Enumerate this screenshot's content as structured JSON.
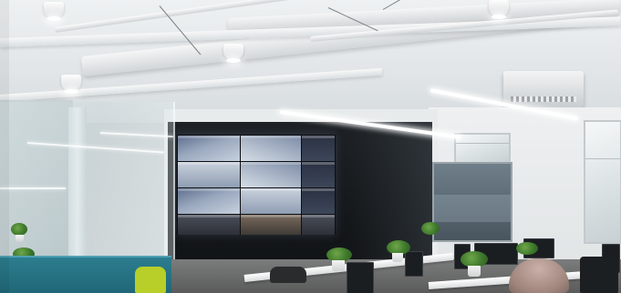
{
  "scene": {
    "type": "photo",
    "description_tags": [
      "office-interior",
      "ceiling-lights",
      "video-wall",
      "desks",
      "plants",
      "glass-partition"
    ]
  },
  "video_wall": {
    "tiles": [
      {
        "label": "",
        "tone": "a"
      },
      {
        "label": "",
        "tone": "b"
      },
      {
        "label": "",
        "tone": "c"
      },
      {
        "label": "",
        "tone": "d"
      },
      {
        "label": "",
        "tone": "b"
      },
      {
        "label": "",
        "tone": "c"
      },
      {
        "label": "",
        "tone": "a"
      },
      {
        "label": "",
        "tone": "d"
      },
      {
        "label": "",
        "tone": "c"
      },
      {
        "label": "",
        "tone": "e"
      },
      {
        "label": "",
        "tone": "f"
      },
      {
        "label": "",
        "tone": "e"
      }
    ]
  },
  "colors": {
    "partition_teal": "#2c7d8f",
    "chair_lime": "#b8cf2a",
    "dark_wall": "#1e2226",
    "ceiling": "#eef1f2"
  }
}
